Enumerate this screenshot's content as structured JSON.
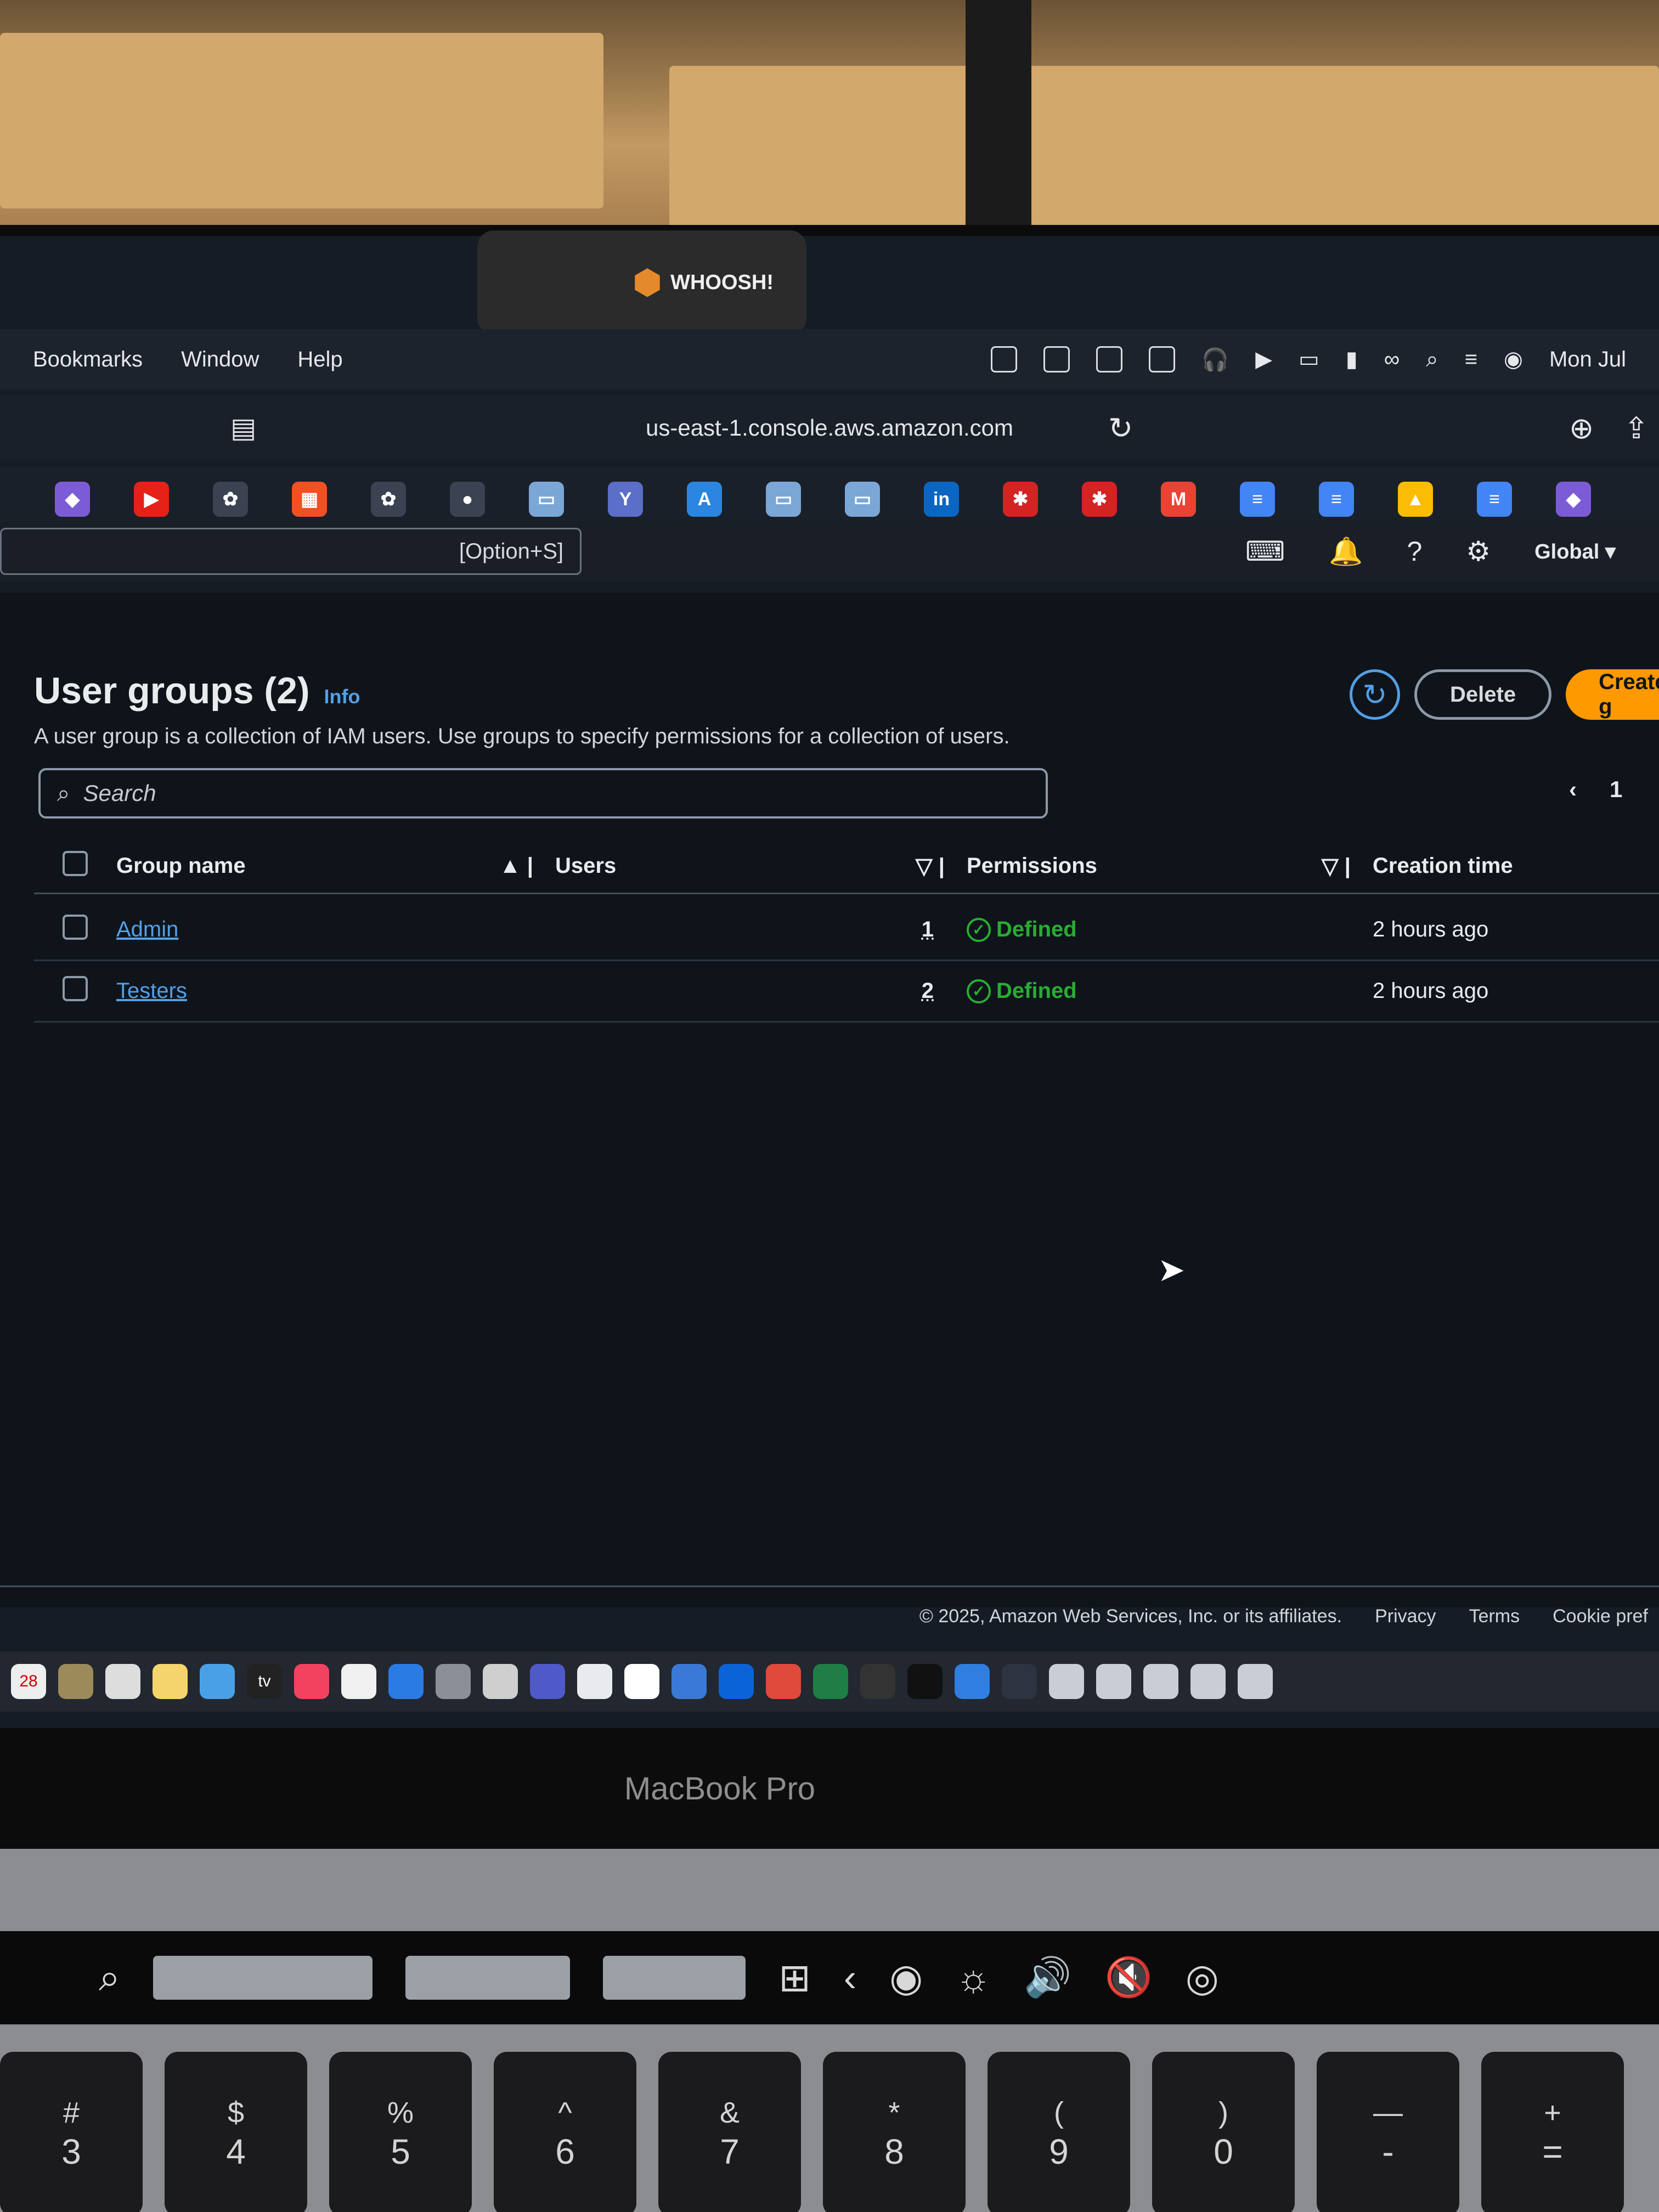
{
  "menubar": {
    "items": [
      "Bookmarks",
      "Window",
      "Help"
    ],
    "clock": "Mon Jul"
  },
  "webcam_cover": {
    "label": "WHOOSH!"
  },
  "browser": {
    "url": "us-east-1.console.aws.amazon.com"
  },
  "aws_nav": {
    "search_shortcut": "[Option+S]",
    "region": "Global"
  },
  "page": {
    "title": "User groups (2)",
    "info": "Info",
    "description": "A user group is a collection of IAM users. Use groups to specify permissions for a collection of users.",
    "actions": {
      "delete": "Delete",
      "create": "Create g"
    },
    "search_placeholder": "Search",
    "pager": {
      "page": "1"
    }
  },
  "table": {
    "columns": [
      "Group name",
      "Users",
      "Permissions",
      "Creation time"
    ],
    "rows": [
      {
        "name": "Admin",
        "users": "1",
        "permissions": "Defined",
        "created": "2 hours ago"
      },
      {
        "name": "Testers",
        "users": "2",
        "permissions": "Defined",
        "created": "2 hours ago"
      }
    ]
  },
  "footer": {
    "copyright": "© 2025, Amazon Web Services, Inc. or its affiliates.",
    "links": [
      "Privacy",
      "Terms",
      "Cookie pref"
    ]
  },
  "dock": {
    "calendar_day": "28",
    "appletv": "tv"
  },
  "laptop": {
    "model": "MacBook Pro"
  },
  "keys": [
    {
      "top": "#",
      "bottom": "3"
    },
    {
      "top": "$",
      "bottom": "4"
    },
    {
      "top": "%",
      "bottom": "5"
    },
    {
      "top": "^",
      "bottom": "6"
    },
    {
      "top": "&",
      "bottom": "7"
    },
    {
      "top": "*",
      "bottom": "8"
    },
    {
      "top": "(",
      "bottom": "9"
    },
    {
      "top": ")",
      "bottom": "0"
    },
    {
      "top": "—",
      "bottom": "-"
    },
    {
      "top": "+",
      "bottom": "="
    }
  ],
  "colors": {
    "accent": "#539fe5",
    "primary_button": "#ff9900",
    "success": "#29ad32"
  }
}
